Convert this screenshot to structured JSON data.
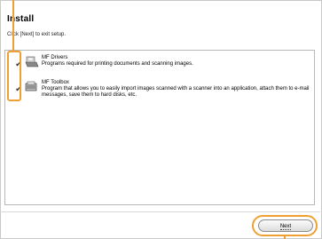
{
  "window": {
    "title": "Install",
    "instruction": "Click [Next] to exit setup."
  },
  "packages": [
    {
      "name": "MF Drivers",
      "description": "Programs required for printing documents and scanning images.",
      "checked": true,
      "icon": "printer-driver-icon"
    },
    {
      "name": "MF Toolbox",
      "description": "Program that allows you to easily import images scanned with a scanner into an application, attach them to e-mail messages, save them to hard disks, etc.",
      "checked": true,
      "icon": "toolbox-icon"
    }
  ],
  "buttons": {
    "next_label": "Next"
  },
  "colors": {
    "callout": "#f0a033",
    "check": "#333333"
  }
}
